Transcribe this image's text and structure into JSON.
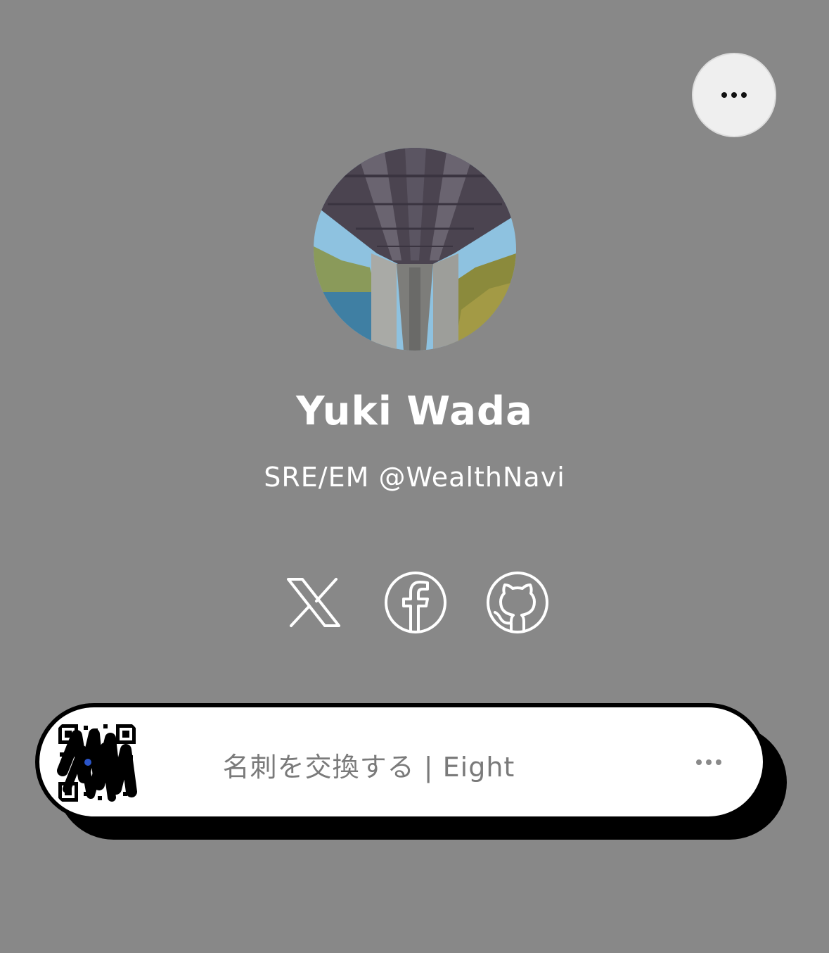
{
  "profile": {
    "name": "Yuki Wada",
    "subtitle": "SRE/EM @WealthNavi"
  },
  "header": {
    "more_icon": "more-horizontal-icon"
  },
  "social_links": [
    {
      "icon": "x-icon"
    },
    {
      "icon": "facebook-icon"
    },
    {
      "icon": "github-icon"
    }
  ],
  "link_card": {
    "title": "名刺を交換する | Eight",
    "thumbnail_icon": "qr-code-icon",
    "more_icon": "more-horizontal-icon"
  },
  "colors": {
    "background": "#888888",
    "card": "#ffffff",
    "card_border": "#000000",
    "card_text": "#7a7a7a",
    "text": "#ffffff"
  }
}
